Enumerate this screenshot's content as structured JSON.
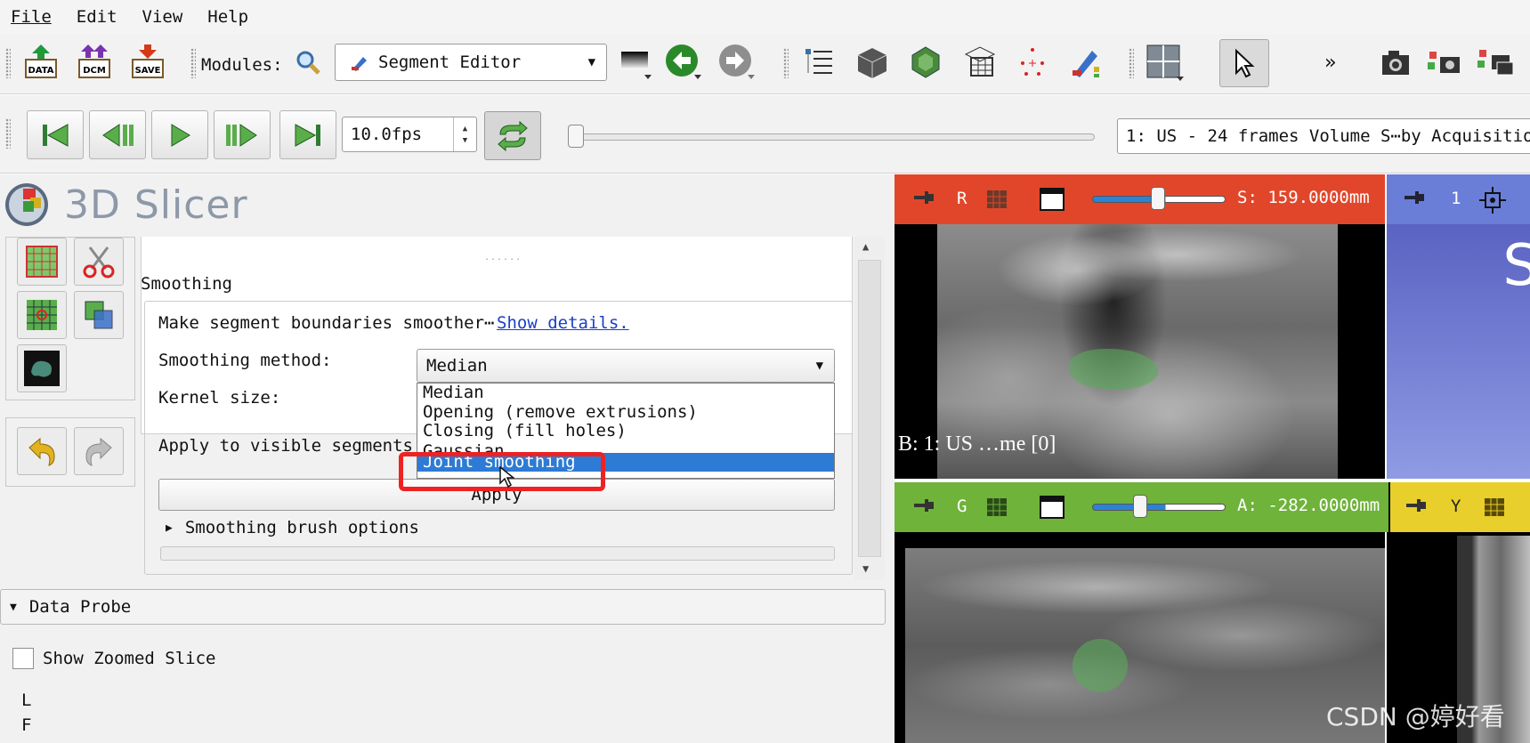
{
  "menu": [
    "File",
    "Edit",
    "View",
    "Help"
  ],
  "toolbar": {
    "modules_label": "Modules:",
    "module_selected": "Segment Editor",
    "data_label": "DATA",
    "dcm_label": "DCM",
    "save_label": "SAVE",
    "overflow": "»"
  },
  "playback": {
    "fps": "10.0fps",
    "volume": "1: US - 24 frames Volume S⋯by Acquisition"
  },
  "app": {
    "title": "3D Slicer"
  },
  "smoothing": {
    "section_title": "Smoothing",
    "description": "Make segment boundaries smoother⋯",
    "details_link": "Show details.",
    "method_label": "Smoothing method:",
    "method_value": "Median",
    "kernel_label": "Kernel size:",
    "apply_visible_label": "Apply to visible segments",
    "apply_button": "Apply",
    "brush_options": "Smoothing brush options",
    "dropdown_options": [
      "Median",
      "Opening (remove extrusions)",
      "Closing (fill holes)",
      "Gaussian",
      "Joint smoothing"
    ],
    "highlighted_option": "Joint smoothing"
  },
  "data_probe": {
    "title": "Data Probe",
    "show_zoomed": "Show Zoomed Slice",
    "coords": [
      "L",
      "F"
    ]
  },
  "views": {
    "red": {
      "letter": "R",
      "offset": "S: 159.0000mm",
      "label": "B: 1: US …me [0]"
    },
    "blue": {
      "letter": "1",
      "overlay": "S"
    },
    "green": {
      "letter": "G",
      "offset": "A: -282.0000mm"
    },
    "yellow": {
      "letter": "Y"
    }
  },
  "watermark": "CSDN @婷好看"
}
